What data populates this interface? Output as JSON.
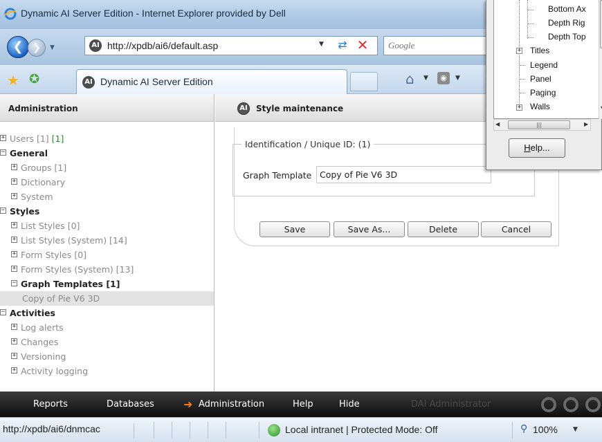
{
  "browser": {
    "title": "Dynamic AI Server Edition - Internet Explorer provided by Dell",
    "address_url": "http://xpdb/ai6/default.asp",
    "search_placeholder": "Google",
    "tab_title": "Dynamic AI Server Edition"
  },
  "left": {
    "header": "Administration",
    "tree": [
      {
        "label": "Users [1]",
        "extra": "[1]",
        "expanded": false,
        "level": 0,
        "active": false
      },
      {
        "label": "General",
        "expanded": true,
        "level": 0,
        "active": true
      },
      {
        "label": "Groups [1]",
        "expanded": false,
        "level": 1,
        "active": false
      },
      {
        "label": "Dictionary",
        "expanded": false,
        "level": 1,
        "active": false
      },
      {
        "label": "System",
        "expanded": false,
        "level": 1,
        "active": false
      },
      {
        "label": "Styles",
        "expanded": true,
        "level": 0,
        "active": true
      },
      {
        "label": "List Styles [0]",
        "expanded": false,
        "level": 1,
        "active": false
      },
      {
        "label": "List Styles (System) [14]",
        "expanded": false,
        "level": 1,
        "active": false
      },
      {
        "label": "Form Styles [0]",
        "expanded": false,
        "level": 1,
        "active": false
      },
      {
        "label": "Form Styles (System) [13]",
        "expanded": false,
        "level": 1,
        "active": false
      },
      {
        "label": "Graph Templates [1]",
        "expanded": true,
        "level": 1,
        "active": true
      },
      {
        "label": "Copy of Pie V6 3D",
        "level": 2,
        "selected": true
      },
      {
        "label": "Activities",
        "expanded": true,
        "level": 0,
        "active": true
      },
      {
        "label": "Log alerts",
        "expanded": false,
        "level": 1,
        "active": false
      },
      {
        "label": "Changes",
        "expanded": false,
        "level": 1,
        "active": false
      },
      {
        "label": "Versioning",
        "expanded": false,
        "level": 1,
        "active": false
      },
      {
        "label": "Activity logging",
        "expanded": false,
        "level": 1,
        "active": false
      }
    ]
  },
  "main": {
    "header": "Style maintenance",
    "legend": "Identification / Unique ID: (1)",
    "template_label": "Graph Template",
    "template_value": "Copy of Pie V6 3D",
    "buttons": {
      "save": "Save",
      "save_as": "Save As...",
      "delete": "Delete",
      "cancel": "Cancel"
    }
  },
  "appnav": {
    "reports": "Reports",
    "databases": "Databases",
    "administration": "Administration",
    "help": "Help",
    "hide": "Hide",
    "user": "DAI Administrator"
  },
  "status": {
    "url": "http://xpdb/ai6/dnmcac",
    "zone": "Local intranet | Protected Mode: Off",
    "zoom": "100%"
  },
  "dialog": {
    "items": [
      "Bottom Ax",
      "Depth Rig",
      "Depth Top",
      "Titles",
      "Legend",
      "Panel",
      "Paging",
      "Walls"
    ],
    "help_label": "Help..."
  },
  "colors": {
    "accent_orange": "#f07b1e",
    "count_green": "#2b8a2b",
    "muted_gray": "#8a8a8a"
  }
}
